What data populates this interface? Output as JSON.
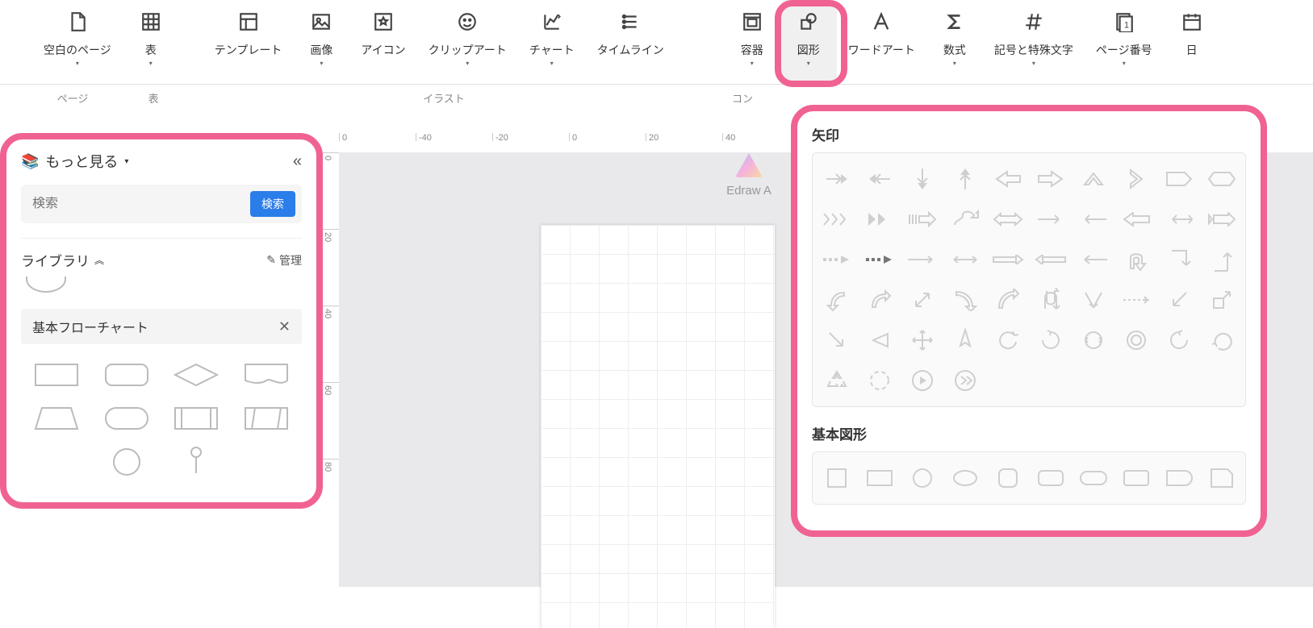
{
  "ribbon": {
    "items": [
      {
        "label": "空白のページ",
        "key": "blank-page"
      },
      {
        "label": "表",
        "key": "table"
      },
      {
        "label": "テンプレート",
        "key": "template"
      },
      {
        "label": "画像",
        "key": "image"
      },
      {
        "label": "アイコン",
        "key": "icon"
      },
      {
        "label": "クリップアート",
        "key": "clipart"
      },
      {
        "label": "チャート",
        "key": "chart"
      },
      {
        "label": "タイムライン",
        "key": "timeline"
      },
      {
        "label": "容器",
        "key": "container"
      },
      {
        "label": "図形",
        "key": "shape"
      },
      {
        "label": "ワードアート",
        "key": "wordart"
      },
      {
        "label": "数式",
        "key": "formula"
      },
      {
        "label": "記号と特殊文字",
        "key": "symbols"
      },
      {
        "label": "ページ番号",
        "key": "page-number"
      },
      {
        "label": "日",
        "key": "date"
      }
    ],
    "groups": {
      "page": "ページ",
      "table": "表",
      "illustration": "イラスト",
      "component": "コン"
    }
  },
  "left_panel": {
    "more": "もっと見る",
    "search_placeholder": "検索",
    "search_btn": "検索",
    "library": "ライブラリ",
    "manage": "管理",
    "category": "基本フローチャート"
  },
  "ruler_h": [
    "0",
    "-40",
    "-20",
    "0",
    "20",
    "40"
  ],
  "ruler_v": [
    "0",
    "20",
    "40",
    "60",
    "80"
  ],
  "ai_label": "Edraw A",
  "popover": {
    "section_arrows": "矢印",
    "section_basic": "基本図形"
  }
}
